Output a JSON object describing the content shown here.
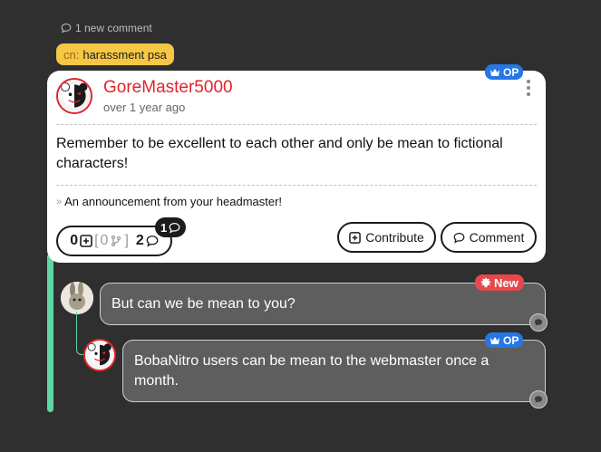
{
  "new_comments": {
    "label": "1 new comment",
    "icon": "speech-bubble-icon"
  },
  "content_notice": {
    "prefix": "cn:",
    "label": "harassment psa",
    "color": "#f6c745"
  },
  "post": {
    "author": "GoreMaster5000",
    "author_color": "#e2232b",
    "badge": "OP",
    "time": "over 1 year ago",
    "body": "Remember to be excellent to each other and only be mean to fictional characters!",
    "footer_text": "An announcement from your headmaster!",
    "stats": {
      "contributions": "0",
      "threads": "0",
      "comments": "2"
    },
    "thread_count": "1",
    "buttons": {
      "contribute": "Contribute",
      "comment": "Comment"
    }
  },
  "replies": [
    {
      "text": "But can we be mean to you?",
      "badge": "New",
      "badge_color": "#e5484d"
    },
    {
      "text": "BobaNitro users can be mean to the webmaster once a month.",
      "badge": "OP",
      "badge_color": "#2577e6"
    }
  ],
  "colors": {
    "background": "#2f2f30",
    "accent": "#5fd6a2",
    "op_badge": "#2577e6"
  }
}
